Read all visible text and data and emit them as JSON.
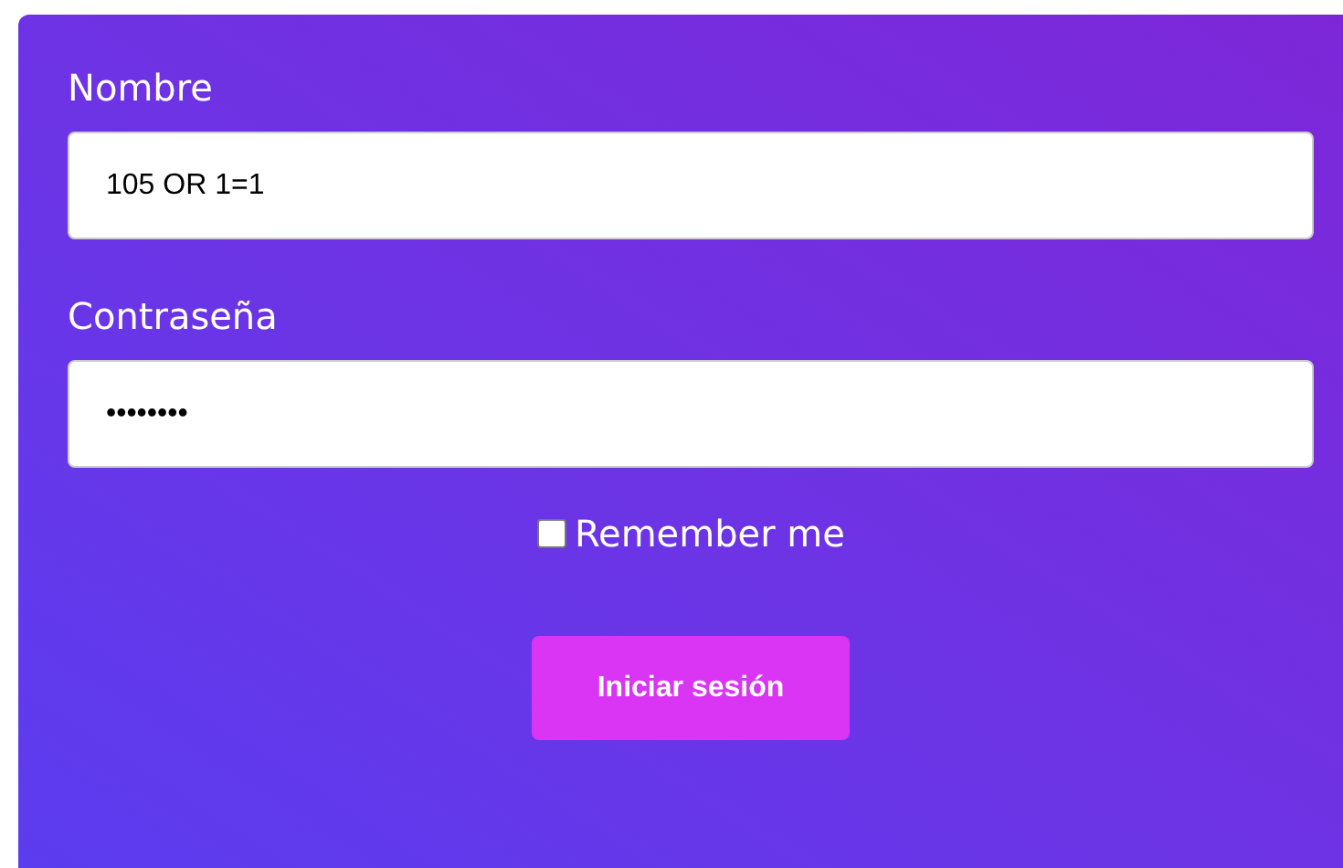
{
  "fields": [
    {
      "label": "Nombre",
      "value": "105 OR 1=1"
    },
    {
      "label": "Contraseña",
      "value": "••••••••"
    }
  ],
  "remember": {
    "label": "Remember me",
    "checked": false
  },
  "submit": {
    "label": "Iniciar sesión"
  }
}
